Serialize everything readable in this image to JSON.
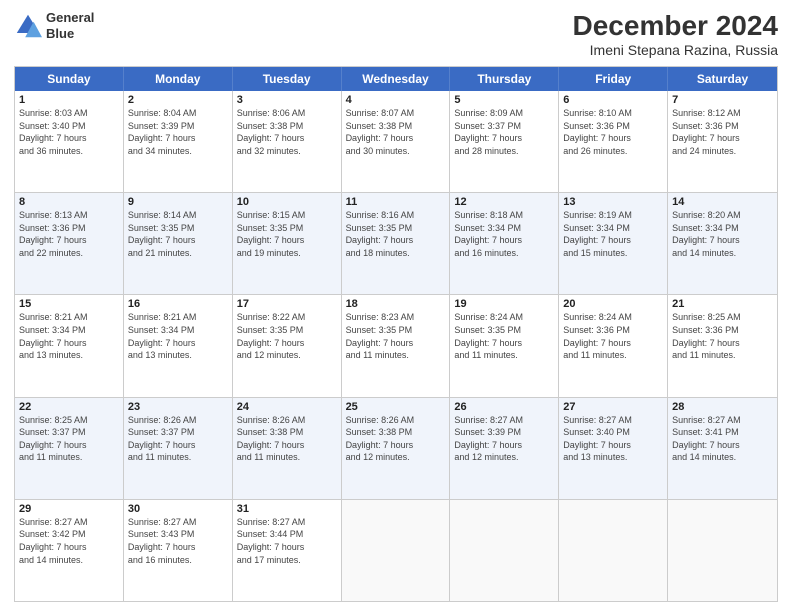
{
  "header": {
    "logo_line1": "General",
    "logo_line2": "Blue",
    "title": "December 2024",
    "subtitle": "Imeni Stepana Razina, Russia"
  },
  "weekdays": [
    "Sunday",
    "Monday",
    "Tuesday",
    "Wednesday",
    "Thursday",
    "Friday",
    "Saturday"
  ],
  "rows": [
    [
      {
        "day": "1",
        "info": "Sunrise: 8:03 AM\nSunset: 3:40 PM\nDaylight: 7 hours\nand 36 minutes."
      },
      {
        "day": "2",
        "info": "Sunrise: 8:04 AM\nSunset: 3:39 PM\nDaylight: 7 hours\nand 34 minutes."
      },
      {
        "day": "3",
        "info": "Sunrise: 8:06 AM\nSunset: 3:38 PM\nDaylight: 7 hours\nand 32 minutes."
      },
      {
        "day": "4",
        "info": "Sunrise: 8:07 AM\nSunset: 3:38 PM\nDaylight: 7 hours\nand 30 minutes."
      },
      {
        "day": "5",
        "info": "Sunrise: 8:09 AM\nSunset: 3:37 PM\nDaylight: 7 hours\nand 28 minutes."
      },
      {
        "day": "6",
        "info": "Sunrise: 8:10 AM\nSunset: 3:36 PM\nDaylight: 7 hours\nand 26 minutes."
      },
      {
        "day": "7",
        "info": "Sunrise: 8:12 AM\nSunset: 3:36 PM\nDaylight: 7 hours\nand 24 minutes."
      }
    ],
    [
      {
        "day": "8",
        "info": "Sunrise: 8:13 AM\nSunset: 3:36 PM\nDaylight: 7 hours\nand 22 minutes."
      },
      {
        "day": "9",
        "info": "Sunrise: 8:14 AM\nSunset: 3:35 PM\nDaylight: 7 hours\nand 21 minutes."
      },
      {
        "day": "10",
        "info": "Sunrise: 8:15 AM\nSunset: 3:35 PM\nDaylight: 7 hours\nand 19 minutes."
      },
      {
        "day": "11",
        "info": "Sunrise: 8:16 AM\nSunset: 3:35 PM\nDaylight: 7 hours\nand 18 minutes."
      },
      {
        "day": "12",
        "info": "Sunrise: 8:18 AM\nSunset: 3:34 PM\nDaylight: 7 hours\nand 16 minutes."
      },
      {
        "day": "13",
        "info": "Sunrise: 8:19 AM\nSunset: 3:34 PM\nDaylight: 7 hours\nand 15 minutes."
      },
      {
        "day": "14",
        "info": "Sunrise: 8:20 AM\nSunset: 3:34 PM\nDaylight: 7 hours\nand 14 minutes."
      }
    ],
    [
      {
        "day": "15",
        "info": "Sunrise: 8:21 AM\nSunset: 3:34 PM\nDaylight: 7 hours\nand 13 minutes."
      },
      {
        "day": "16",
        "info": "Sunrise: 8:21 AM\nSunset: 3:34 PM\nDaylight: 7 hours\nand 13 minutes."
      },
      {
        "day": "17",
        "info": "Sunrise: 8:22 AM\nSunset: 3:35 PM\nDaylight: 7 hours\nand 12 minutes."
      },
      {
        "day": "18",
        "info": "Sunrise: 8:23 AM\nSunset: 3:35 PM\nDaylight: 7 hours\nand 11 minutes."
      },
      {
        "day": "19",
        "info": "Sunrise: 8:24 AM\nSunset: 3:35 PM\nDaylight: 7 hours\nand 11 minutes."
      },
      {
        "day": "20",
        "info": "Sunrise: 8:24 AM\nSunset: 3:36 PM\nDaylight: 7 hours\nand 11 minutes."
      },
      {
        "day": "21",
        "info": "Sunrise: 8:25 AM\nSunset: 3:36 PM\nDaylight: 7 hours\nand 11 minutes."
      }
    ],
    [
      {
        "day": "22",
        "info": "Sunrise: 8:25 AM\nSunset: 3:37 PM\nDaylight: 7 hours\nand 11 minutes."
      },
      {
        "day": "23",
        "info": "Sunrise: 8:26 AM\nSunset: 3:37 PM\nDaylight: 7 hours\nand 11 minutes."
      },
      {
        "day": "24",
        "info": "Sunrise: 8:26 AM\nSunset: 3:38 PM\nDaylight: 7 hours\nand 11 minutes."
      },
      {
        "day": "25",
        "info": "Sunrise: 8:26 AM\nSunset: 3:38 PM\nDaylight: 7 hours\nand 12 minutes."
      },
      {
        "day": "26",
        "info": "Sunrise: 8:27 AM\nSunset: 3:39 PM\nDaylight: 7 hours\nand 12 minutes."
      },
      {
        "day": "27",
        "info": "Sunrise: 8:27 AM\nSunset: 3:40 PM\nDaylight: 7 hours\nand 13 minutes."
      },
      {
        "day": "28",
        "info": "Sunrise: 8:27 AM\nSunset: 3:41 PM\nDaylight: 7 hours\nand 14 minutes."
      }
    ],
    [
      {
        "day": "29",
        "info": "Sunrise: 8:27 AM\nSunset: 3:42 PM\nDaylight: 7 hours\nand 14 minutes."
      },
      {
        "day": "30",
        "info": "Sunrise: 8:27 AM\nSunset: 3:43 PM\nDaylight: 7 hours\nand 16 minutes."
      },
      {
        "day": "31",
        "info": "Sunrise: 8:27 AM\nSunset: 3:44 PM\nDaylight: 7 hours\nand 17 minutes."
      },
      null,
      null,
      null,
      null
    ]
  ]
}
